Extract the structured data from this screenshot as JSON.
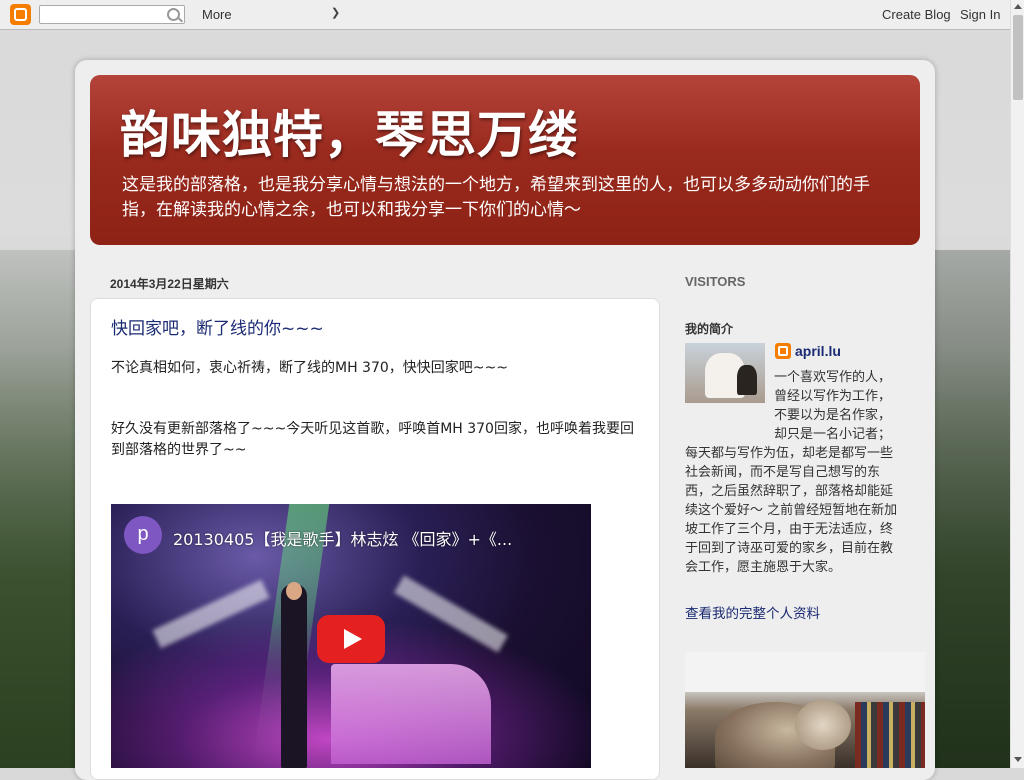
{
  "navbar": {
    "logo_icon": "blogger-icon",
    "search_icon": "search-icon",
    "search_value": "",
    "more_label": "More",
    "more_icon": "chevron-down-icon",
    "create_blog_label": "Create Blog",
    "sign_in_label": "Sign In"
  },
  "header": {
    "title": "韵味独特，琴思万缕",
    "description": "这是我的部落格，也是我分享心情与想法的一个地方，希望来到这里的人，也可以多多动动你们的手指，在解读我的心情之余，也可以和我分享一下你们的心情～"
  },
  "post": {
    "date": "2014年3月22日星期六",
    "title": "快回家吧，断了线的你~~~",
    "paragraph1": "不论真相如何，衷心祈祷，断了线的MH 370，快快回家吧~~~",
    "paragraph2": "好久没有更新部落格了~~~今天听见这首歌，呼唤首MH 370回家，也呼唤着我要回到部落格的世界了~~",
    "video": {
      "channel_avatar_letter": "p",
      "title": "20130405【我是歌手】林志炫 《回家》+《...",
      "play_icon": "play-icon"
    }
  },
  "sidebar": {
    "visitors_heading": "VISITORS",
    "profile_heading": "我的简介",
    "profile_icon": "blogger-icon",
    "profile_name": "april.lu",
    "about": "一个喜欢写作的人，曾经以写作为工作，不要以为是名作家，却只是一名小记者；每天都与写作为伍，却老是都写一些社会新闻，而不是写自己想写的东西，之后虽然辞职了，部落格却能延续这个爱好～    之前曾经短暂地在新加坡工作了三个月，由于无法适应，终于回到了诗巫可爱的家乡，目前在教会工作，愿主施恩于大家。",
    "view_profile_link": "查看我的完整个人资料"
  }
}
